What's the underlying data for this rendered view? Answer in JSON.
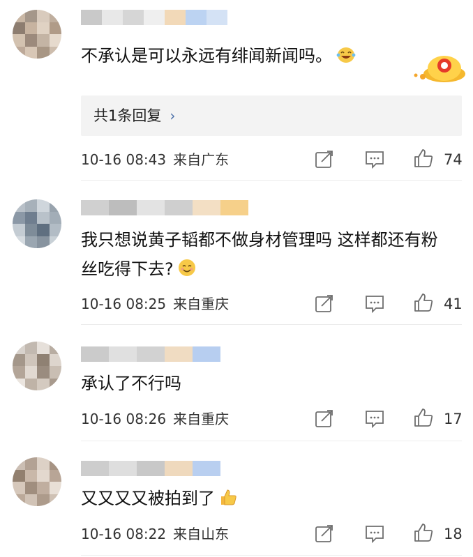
{
  "comments": [
    {
      "text": "不承认是可以永远有绯闻新闻吗。",
      "emoji": "laughing-tears-emoji",
      "reply_label": "共1条回复",
      "reply_chevron": "›",
      "date": "10-16 08:43",
      "location": "来自广东",
      "likes": "74"
    },
    {
      "text": "我只想说黄子韬都不做身材管理吗 这样都还有粉丝吃得下去?",
      "emoji": "smile-emoji",
      "date": "10-16 08:25",
      "location": "来自重庆",
      "likes": "41"
    },
    {
      "text": "承认了不行吗",
      "date": "10-16 08:26",
      "location": "来自重庆",
      "likes": "17"
    },
    {
      "text": "又又又又被拍到了",
      "emoji": "thumbs-up-emoji",
      "date": "10-16 08:22",
      "location": "来自山东",
      "likes": "18"
    }
  ],
  "icons": {
    "share": "share-icon",
    "comment": "comment-icon",
    "like": "like-icon"
  },
  "colors": {
    "reply_link": "#4a6fa8",
    "meta_text": "#333333",
    "reply_bg": "#f3f3f3"
  }
}
